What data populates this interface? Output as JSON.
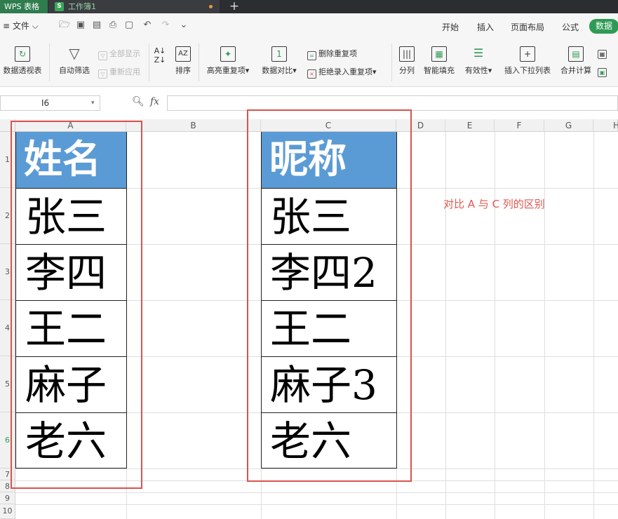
{
  "tabs": {
    "app": "WPS 表格",
    "workbook": "工作簿1",
    "workbook_icon": "S",
    "new_tab": "+"
  },
  "menu": {
    "file": "≡ 文件 ⌵",
    "tabs": [
      "开始",
      "插入",
      "页面布局",
      "公式"
    ],
    "active_tab": "数据"
  },
  "ribbon": {
    "pivot": "数据透视表",
    "autofilter": "自动筛选",
    "show_all": "全部显示",
    "reapply": "重新应用",
    "sort": "排序",
    "highlight_dup": "高亮重复项",
    "compare": "数据对比",
    "remove_dup": "删除重复项",
    "reject_dup": "拒绝录入重复项",
    "split": "分列",
    "smart_fill": "智能填充",
    "validity": "有效性",
    "insert_dropdown": "插入下拉列表",
    "merge_calc": "合并计算"
  },
  "formula_bar": {
    "cell_ref": "I6",
    "fx": "fx",
    "value": ""
  },
  "columns": [
    "A",
    "B",
    "C",
    "D",
    "E",
    "F",
    "G",
    "H"
  ],
  "rows": [
    "1",
    "2",
    "3",
    "4",
    "5",
    "6",
    "7",
    "8",
    "9",
    "10"
  ],
  "sheet": {
    "colA_header": "姓名",
    "colC_header": "昵称",
    "colA": [
      "张三",
      "李四",
      "王二",
      "麻子",
      "老六"
    ],
    "colC": [
      "张三",
      "李四2",
      "王二",
      "麻子3",
      "老六"
    ],
    "note": "对比 A 与 C 列的区别"
  },
  "colors": {
    "accent": "#2e9b55",
    "header_fill": "#5b9bd5",
    "highlight": "#d9534f"
  }
}
